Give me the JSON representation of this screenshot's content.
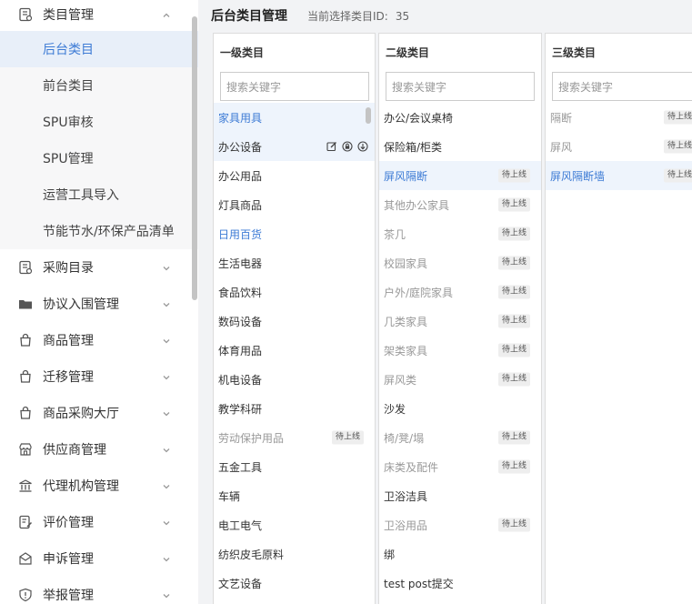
{
  "sidebar": {
    "top_item": {
      "label": "类目管理",
      "icon": "category-list-icon"
    },
    "sub_items": [
      {
        "label": "后台类目",
        "active": true
      },
      {
        "label": "前台类目"
      },
      {
        "label": "SPU审核"
      },
      {
        "label": "SPU管理"
      },
      {
        "label": "运营工具导入"
      },
      {
        "label": "节能节水/环保产品清单"
      }
    ],
    "items": [
      {
        "label": "采购目录",
        "icon": "catalog-icon"
      },
      {
        "label": "协议入围管理",
        "icon": "folder-icon"
      },
      {
        "label": "商品管理",
        "icon": "bag-icon"
      },
      {
        "label": "迁移管理",
        "icon": "bag-icon"
      },
      {
        "label": "商品采购大厅",
        "icon": "bag-icon"
      },
      {
        "label": "供应商管理",
        "icon": "store-icon"
      },
      {
        "label": "代理机构管理",
        "icon": "bank-icon"
      },
      {
        "label": "评价管理",
        "icon": "edit-doc-icon"
      },
      {
        "label": "申诉管理",
        "icon": "mail-icon"
      },
      {
        "label": "举报管理",
        "icon": "shield-icon"
      }
    ]
  },
  "header": {
    "title": "后台类目管理",
    "selected_label": "当前选择类目ID:",
    "selected_value": "35"
  },
  "columns": [
    {
      "title": "一级类目",
      "placeholder": "搜索关键字",
      "rows": [
        {
          "label": "家具用具",
          "state": "blue",
          "selected": true
        },
        {
          "label": "办公设备",
          "state": "normal",
          "selected": true,
          "icons": true
        },
        {
          "label": "办公用品",
          "state": "normal"
        },
        {
          "label": "灯具商品",
          "state": "normal"
        },
        {
          "label": "日用百货",
          "state": "blue"
        },
        {
          "label": "生活电器",
          "state": "normal"
        },
        {
          "label": "食品饮料",
          "state": "normal"
        },
        {
          "label": "数码设备",
          "state": "normal"
        },
        {
          "label": "体育用品",
          "state": "normal"
        },
        {
          "label": "机电设备",
          "state": "normal"
        },
        {
          "label": "教学科研",
          "state": "normal"
        },
        {
          "label": "劳动保护用品",
          "state": "gray",
          "badge": "待上线"
        },
        {
          "label": "五金工具",
          "state": "normal"
        },
        {
          "label": "车辆",
          "state": "normal"
        },
        {
          "label": "电工电气",
          "state": "normal"
        },
        {
          "label": "纺织皮毛原料",
          "state": "normal"
        },
        {
          "label": "文艺设备",
          "state": "normal"
        }
      ]
    },
    {
      "title": "二级类目",
      "placeholder": "搜索关键字",
      "rows": [
        {
          "label": "办公/会议桌椅",
          "state": "normal"
        },
        {
          "label": "保险箱/柜类",
          "state": "normal"
        },
        {
          "label": "屏风隔断",
          "state": "blue",
          "selected": true,
          "badge": "待上线"
        },
        {
          "label": "其他办公家具",
          "state": "gray",
          "badge": "待上线"
        },
        {
          "label": "茶几",
          "state": "gray",
          "badge": "待上线"
        },
        {
          "label": "校园家具",
          "state": "gray",
          "badge": "待上线"
        },
        {
          "label": "户外/庭院家具",
          "state": "gray",
          "badge": "待上线"
        },
        {
          "label": "几类家具",
          "state": "gray",
          "badge": "待上线"
        },
        {
          "label": "架类家具",
          "state": "gray",
          "badge": "待上线"
        },
        {
          "label": "屏风类",
          "state": "gray",
          "badge": "待上线"
        },
        {
          "label": "沙发",
          "state": "normal"
        },
        {
          "label": "椅/凳/塌",
          "state": "gray",
          "badge": "待上线"
        },
        {
          "label": "床类及配件",
          "state": "gray",
          "badge": "待上线"
        },
        {
          "label": "卫浴洁具",
          "state": "normal"
        },
        {
          "label": "卫浴用品",
          "state": "gray",
          "badge": "待上线"
        },
        {
          "label": "绑",
          "state": "normal"
        },
        {
          "label": "test post提交",
          "state": "normal"
        }
      ]
    },
    {
      "title": "三级类目",
      "placeholder": "搜索关键字",
      "rows": [
        {
          "label": "隔断",
          "state": "gray",
          "badge": "待上线"
        },
        {
          "label": "屏风",
          "state": "gray",
          "badge": "待上线"
        },
        {
          "label": "屏风隔断墙",
          "state": "blue",
          "selected": true,
          "badge": "待上线"
        }
      ]
    }
  ],
  "colors": {
    "accent": "#3d7bd5",
    "selected_bg": "#eef4fc"
  }
}
